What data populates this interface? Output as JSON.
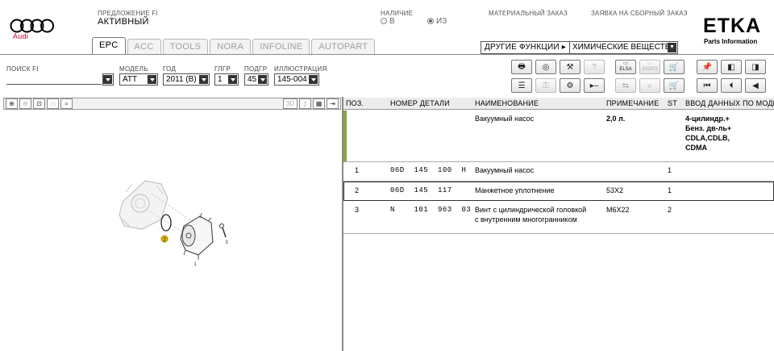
{
  "header": {
    "brand": "Audi",
    "offer_label": "ПРЕДЛОЖЕНИЕ FI",
    "offer_value": "АКТИВНЫЙ",
    "availability_label": "НАЛИЧИЕ",
    "availability_options": [
      "В",
      "ИЗ"
    ],
    "availability_selected": "ИЗ",
    "material_order": "МАТЕРИАЛЬНЫЙ ЗАКАЗ",
    "assembly_order": "ЗАЯВКА НА СБОРНЫЙ ЗАКАЗ",
    "app_title": "ETKA",
    "app_subtitle": "Parts Information"
  },
  "tabs": [
    "EPC",
    "ACC",
    "TOOLS",
    "NORA",
    "INFOLINE",
    "AUTOPART"
  ],
  "active_tab": "EPC",
  "functions": {
    "button_label": "ДРУГИЕ ФУНКЦИИ ▸",
    "selected": "ХИМИЧЕСКИЕ ВЕЩЕСТВА"
  },
  "search": {
    "search_label": "ПОИСК FI",
    "model_label": "МОДЕЛЬ",
    "model_value": "ATT",
    "year_label": "ГОД",
    "year_value": "2011 (B)",
    "mgroup_label": "ГЛГР",
    "mgroup_value": "1",
    "subgroup_label": "ПОДГР",
    "subgroup_value": "45",
    "illustration_label": "ИЛЛЮСТРАЦИЯ",
    "illustration_value": "145-004"
  },
  "toolbar": {
    "elsa_label": "ELSA",
    "dispo_label": "DISPO"
  },
  "illustration": {
    "zoom_3d": "3D",
    "callouts": [
      "1",
      "2",
      "3"
    ]
  },
  "table": {
    "columns": [
      "ПОЗ.",
      "НОМЕР ДЕТАЛИ",
      "НАИМЕНОВАНИЕ",
      "ПРИМЕЧАНИЕ",
      "ST",
      "ВВОД ДАННЫХ ПО МОДЕЛЯМ"
    ],
    "rows": [
      {
        "pos": "",
        "part": "",
        "name": "Вакуумный насос",
        "note": "2,0 л.",
        "st": "",
        "model": "4-цилиндр.+\nБенз. дв-ль+\nCDLA,CDLB,\nCDMA"
      },
      {
        "pos": "1",
        "part": "06D  145  100  H",
        "name": "Вакуумный насос",
        "note": "",
        "st": "1",
        "model": ""
      },
      {
        "pos": "2",
        "part": "06D  145  117",
        "name": "Манжетное уплотнение",
        "note": "53X2",
        "st": "1",
        "model": ""
      },
      {
        "pos": "3",
        "part": "N    101  963  03",
        "name": "Винт с цилиндрической головкой\nс внутренним многогранником",
        "note": "M6X22",
        "st": "2",
        "model": ""
      }
    ]
  },
  "colors": {
    "audi_red": "#c0002a",
    "header_row_accent": "#8aa63c",
    "callout_yellow": "#e6b800"
  }
}
